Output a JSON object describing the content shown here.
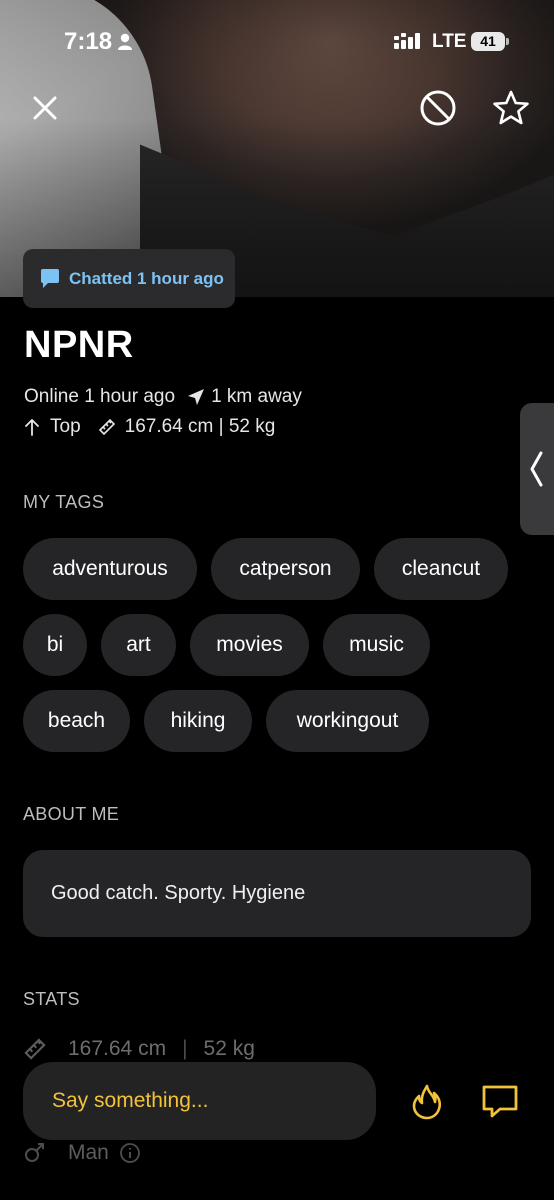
{
  "status_bar": {
    "time": "7:18",
    "network": "LTE",
    "battery": "41"
  },
  "colors": {
    "accent_yellow": "#f2c23a",
    "chat_blue": "#7cc3f3",
    "pill_bg": "#252527"
  },
  "header": {
    "close_icon": "close-icon",
    "block_icon": "block-icon",
    "favorite_icon": "star-icon"
  },
  "chatted": {
    "label": "Chatted 1 hour ago",
    "icon": "chat-bubble-icon"
  },
  "profile": {
    "name": "NPNR",
    "online": "Online 1 hour ago",
    "distance": "1 km away",
    "position": "Top",
    "height_weight": "167.64 cm | 52 kg"
  },
  "tags_section": {
    "title": "MY TAGS",
    "tags": [
      "adventurous",
      "catperson",
      "cleancut",
      "bi",
      "art",
      "movies",
      "music",
      "beach",
      "hiking",
      "workingout"
    ]
  },
  "about_section": {
    "title": "ABOUT ME",
    "text": "Good catch. Sporty. Hygiene"
  },
  "stats_section": {
    "title": "STATS",
    "height": "167.64 cm",
    "separator": "|",
    "weight": "52 kg",
    "gender": "Man"
  },
  "composer": {
    "placeholder": "Say something..."
  }
}
